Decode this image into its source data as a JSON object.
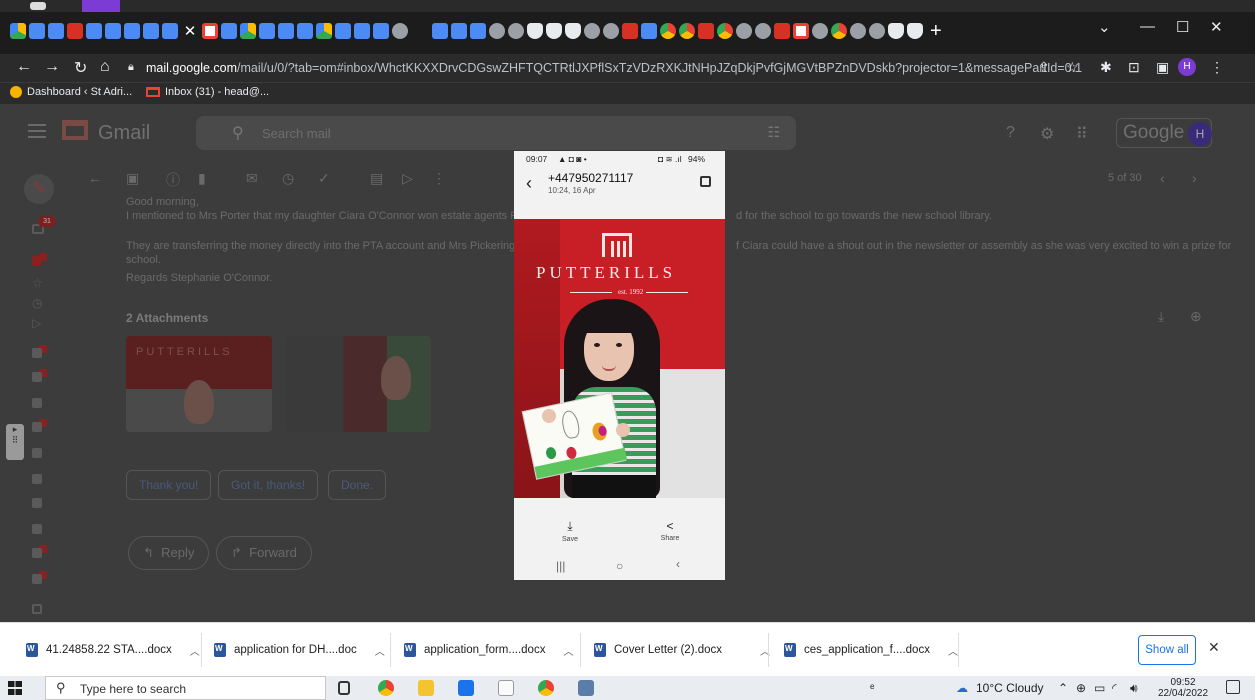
{
  "browser": {
    "url_host": "mail.google.com",
    "url_rest": "/mail/u/0/?tab=om#inbox/WhctKKXXDrvCDGswZHFTQCTRtlJXPflSxTzVDzRXKJtNHpJZqDkjPvfGjMGVtBPZnDVDskb?projector=1&messagePartId=0.1",
    "profile_initial": "H",
    "bookmarks": [
      {
        "label": "Dashboard ‹ St Adri..."
      },
      {
        "label": "Inbox (31) - head@..."
      }
    ]
  },
  "gmail": {
    "brand": "Gmail",
    "search_placeholder": "Search mail",
    "google_word": "Google",
    "avatar_initial": "H",
    "pager": "5 of 30",
    "inbox_badge": "31",
    "greeting": "Good morning,",
    "line1_a": "I mentioned to Mrs Porter that my daughter Ciara O'Connor won estate agents Putt",
    "line1_b": "d for the school to go towards the new school library.",
    "line2_a": "They are transferring the money directly into the PTA account and Mrs Pickering ar",
    "line2_b": "f Ciara could have a shout out in the newsletter or assembly as she was very excited to win a prize for",
    "line3": "school.",
    "signoff": "Regards Stephanie O'Connor.",
    "attachments_title": "2 Attachments",
    "thumb_word": "PUTTERILLS",
    "smart_replies": [
      "Thank you!",
      "Got it, thanks!",
      "Done."
    ],
    "reply_label": "Reply",
    "forward_label": "Forward"
  },
  "phone": {
    "time": "09:07",
    "battery": "94%",
    "sender": "+447950271117",
    "received": "10:24, 16 Apr",
    "brand_word": "PUTTERILLS",
    "brand_est": "est. 1992",
    "save_label": "Save",
    "share_label": "Share"
  },
  "downloads": [
    {
      "name": "41.24858.22 STA....docx"
    },
    {
      "name": "application for DH....doc"
    },
    {
      "name": "application_form....docx"
    },
    {
      "name": "Cover Letter (2).docx"
    },
    {
      "name": "ces_application_f....docx"
    }
  ],
  "downloads_show_all": "Show all",
  "taskbar": {
    "search_placeholder": "Type here to search",
    "weather": "10°C  Cloudy",
    "time": "09:52",
    "date": "22/04/2022"
  }
}
